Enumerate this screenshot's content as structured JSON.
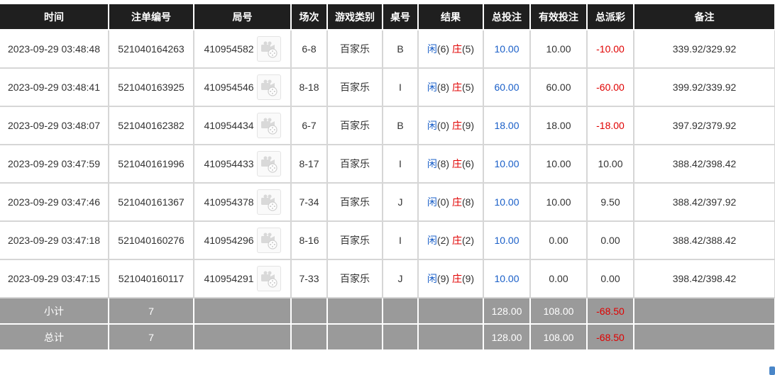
{
  "columns": [
    "时间",
    "注单编号",
    "局号",
    "场次",
    "游戏类别",
    "桌号",
    "结果",
    "总投注",
    "有效投注",
    "总派彩",
    "备注"
  ],
  "labels": {
    "player": "闲",
    "banker": "庄"
  },
  "colors": {
    "header_bg": "#1f1f1f",
    "summary_bg": "#9a9a9a",
    "link_blue": "#1a5fc8",
    "negative_red": "#e00000"
  },
  "icons": {
    "replay": "video-replay-icon"
  },
  "rows": [
    {
      "time": "2023-09-29 03:48:48",
      "bet_no": "521040164263",
      "round_no": "410954582",
      "session": "6-8",
      "game": "百家乐",
      "table": "B",
      "player": "(6)",
      "banker": "(5)",
      "total_bet": "10.00",
      "valid_bet": "10.00",
      "payout": "-10.00",
      "payout_negative": true,
      "note": "339.92/329.92"
    },
    {
      "time": "2023-09-29 03:48:41",
      "bet_no": "521040163925",
      "round_no": "410954546",
      "session": "8-18",
      "game": "百家乐",
      "table": "I",
      "player": "(8)",
      "banker": "(5)",
      "total_bet": "60.00",
      "valid_bet": "60.00",
      "payout": "-60.00",
      "payout_negative": true,
      "note": "399.92/339.92"
    },
    {
      "time": "2023-09-29 03:48:07",
      "bet_no": "521040162382",
      "round_no": "410954434",
      "session": "6-7",
      "game": "百家乐",
      "table": "B",
      "player": "(0)",
      "banker": "(9)",
      "total_bet": "18.00",
      "valid_bet": "18.00",
      "payout": "-18.00",
      "payout_negative": true,
      "note": "397.92/379.92"
    },
    {
      "time": "2023-09-29 03:47:59",
      "bet_no": "521040161996",
      "round_no": "410954433",
      "session": "8-17",
      "game": "百家乐",
      "table": "I",
      "player": "(8)",
      "banker": "(6)",
      "total_bet": "10.00",
      "valid_bet": "10.00",
      "payout": "10.00",
      "payout_negative": false,
      "note": "388.42/398.42"
    },
    {
      "time": "2023-09-29 03:47:46",
      "bet_no": "521040161367",
      "round_no": "410954378",
      "session": "7-34",
      "game": "百家乐",
      "table": "J",
      "player": "(0)",
      "banker": "(8)",
      "total_bet": "10.00",
      "valid_bet": "10.00",
      "payout": "9.50",
      "payout_negative": false,
      "note": "388.42/397.92"
    },
    {
      "time": "2023-09-29 03:47:18",
      "bet_no": "521040160276",
      "round_no": "410954296",
      "session": "8-16",
      "game": "百家乐",
      "table": "I",
      "player": "(2)",
      "banker": "(2)",
      "total_bet": "10.00",
      "valid_bet": "0.00",
      "payout": "0.00",
      "payout_negative": false,
      "note": "388.42/388.42"
    },
    {
      "time": "2023-09-29 03:47:15",
      "bet_no": "521040160117",
      "round_no": "410954291",
      "session": "7-33",
      "game": "百家乐",
      "table": "J",
      "player": "(9)",
      "banker": "(9)",
      "total_bet": "10.00",
      "valid_bet": "0.00",
      "payout": "0.00",
      "payout_negative": false,
      "note": "398.42/398.42"
    }
  ],
  "subtotal": {
    "label": "小计",
    "count": "7",
    "total_bet": "128.00",
    "valid_bet": "108.00",
    "payout": "-68.50"
  },
  "grandtotal": {
    "label": "总计",
    "count": "7",
    "total_bet": "128.00",
    "valid_bet": "108.00",
    "payout": "-68.50"
  }
}
